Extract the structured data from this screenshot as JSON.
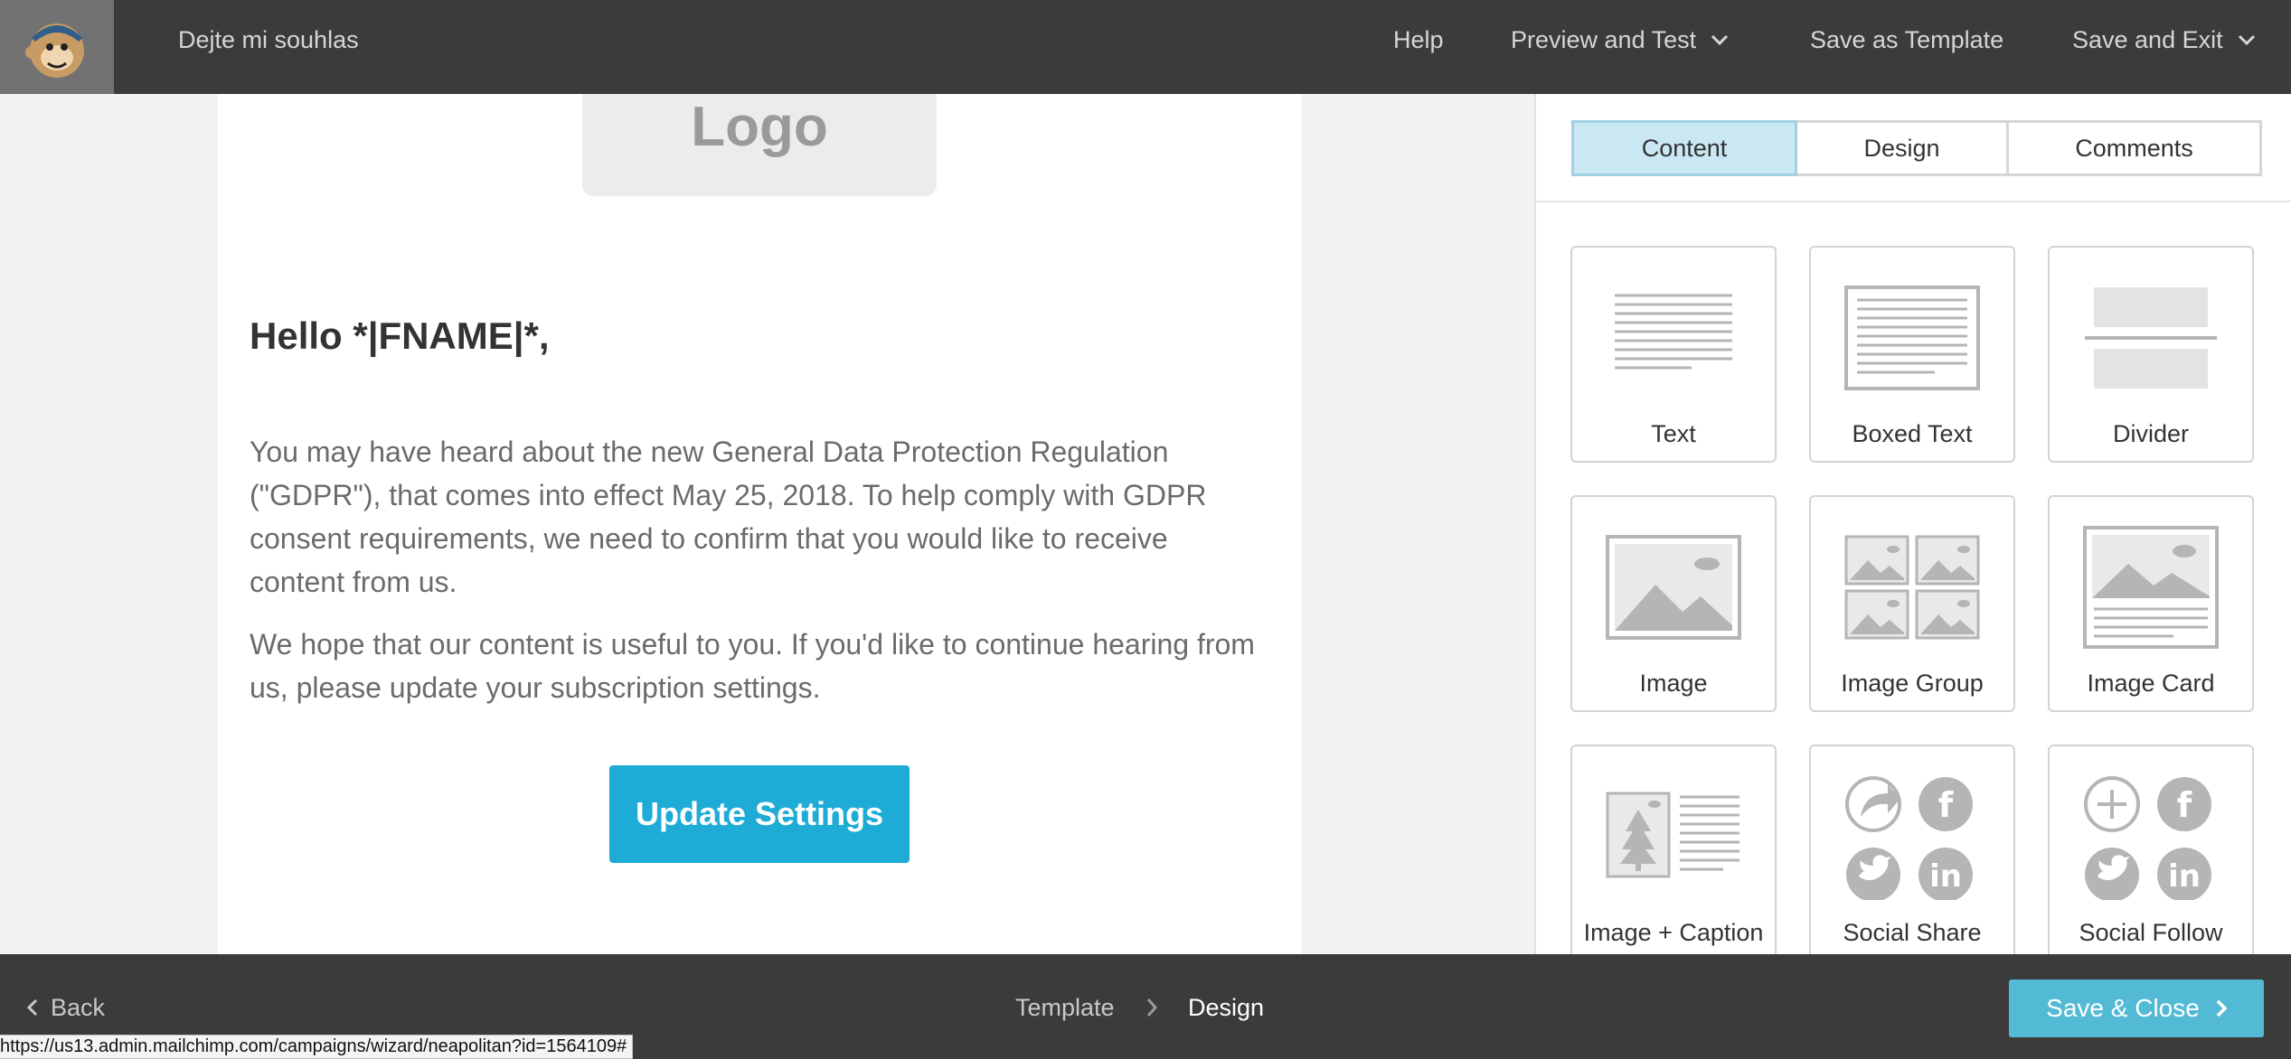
{
  "header": {
    "campaign_title": "Dejte mi souhlas",
    "help_label": "Help",
    "preview_label": "Preview and Test",
    "save_template_label": "Save as Template",
    "save_exit_label": "Save and Exit"
  },
  "email": {
    "logo_text": "Logo",
    "greeting": "Hello *|FNAME|*,",
    "paragraph1": "You may have heard about the new General Data Protection Regulation (\"GDPR\"), that comes into effect May 25, 2018. To help comply with GDPR consent requirements, we need to confirm that you would like to receive content from us.",
    "paragraph2": "We hope that our content is useful to you. If you'd like to continue hearing from us, please update your subscription settings.",
    "button_label": "Update Settings"
  },
  "sidepanel": {
    "tabs": [
      {
        "label": "Content",
        "active": true
      },
      {
        "label": "Design",
        "active": false
      },
      {
        "label": "Comments",
        "active": false
      }
    ],
    "blocks": [
      {
        "label": "Text",
        "icon": "text-block-icon"
      },
      {
        "label": "Boxed Text",
        "icon": "boxed-text-block-icon"
      },
      {
        "label": "Divider",
        "icon": "divider-block-icon"
      },
      {
        "label": "Image",
        "icon": "image-block-icon"
      },
      {
        "label": "Image Group",
        "icon": "image-group-block-icon"
      },
      {
        "label": "Image Card",
        "icon": "image-card-block-icon"
      },
      {
        "label": "Image + Caption",
        "icon": "image-caption-block-icon"
      },
      {
        "label": "Social Share",
        "icon": "social-share-block-icon"
      },
      {
        "label": "Social Follow",
        "icon": "social-follow-block-icon"
      }
    ]
  },
  "footer": {
    "back_label": "Back",
    "crumb_template": "Template",
    "crumb_design": "Design",
    "save_close_label": "Save & Close"
  },
  "status_url": "https://us13.admin.mailchimp.com/campaigns/wizard/neapolitan?id=1564109#",
  "colors": {
    "topbar": "#3b3b3b",
    "accent_button": "#1eacd6",
    "save_close": "#52bad5",
    "active_tab": "#c9e8f4"
  }
}
